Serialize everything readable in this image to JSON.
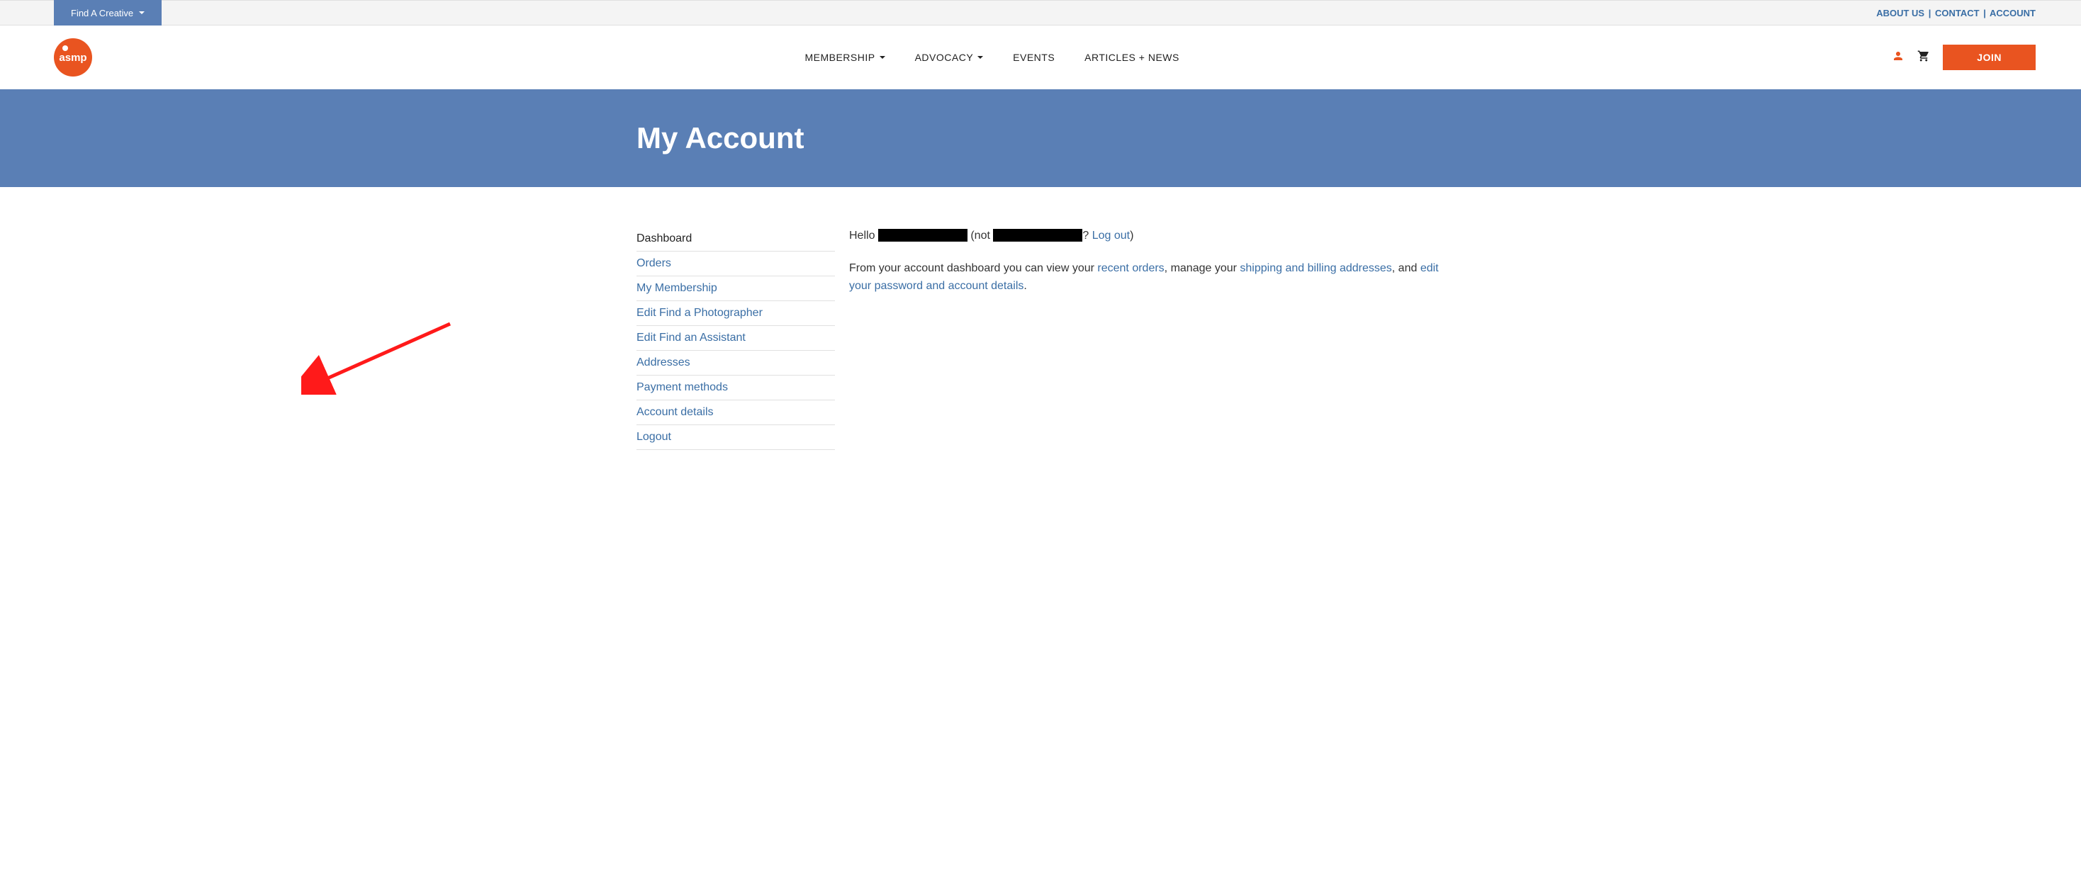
{
  "topbar": {
    "find_creative_label": "Find A Creative",
    "links": {
      "about": "ABOUT US",
      "contact": "CONTACT",
      "account": "ACCOUNT"
    }
  },
  "logo_text": "asmp",
  "nav": {
    "membership": "MEMBERSHIP",
    "advocacy": "ADVOCACY",
    "events": "EVENTS",
    "articles": "ARTICLES + NEWS",
    "join": "JOIN"
  },
  "hero": {
    "title": "My Account"
  },
  "sidebar": {
    "items": [
      {
        "label": "Dashboard",
        "active": true
      },
      {
        "label": "Orders"
      },
      {
        "label": "My Membership"
      },
      {
        "label": "Edit Find a Photographer"
      },
      {
        "label": "Edit Find an Assistant"
      },
      {
        "label": "Addresses"
      },
      {
        "label": "Payment methods"
      },
      {
        "label": "Account details"
      },
      {
        "label": "Logout"
      }
    ]
  },
  "greeting": {
    "hello": "Hello ",
    "not_prefix": " (not ",
    "not_suffix": "? ",
    "logout": "Log out",
    "close_paren": ")"
  },
  "body": {
    "line1_prefix": "From your account dashboard you can view your ",
    "recent_orders": "recent orders",
    "line1_mid": ", manage your ",
    "addresses_link": "shipping and billing addresses",
    "line1_and": ", and ",
    "edit_details": "edit your password and account details",
    "period": "."
  }
}
